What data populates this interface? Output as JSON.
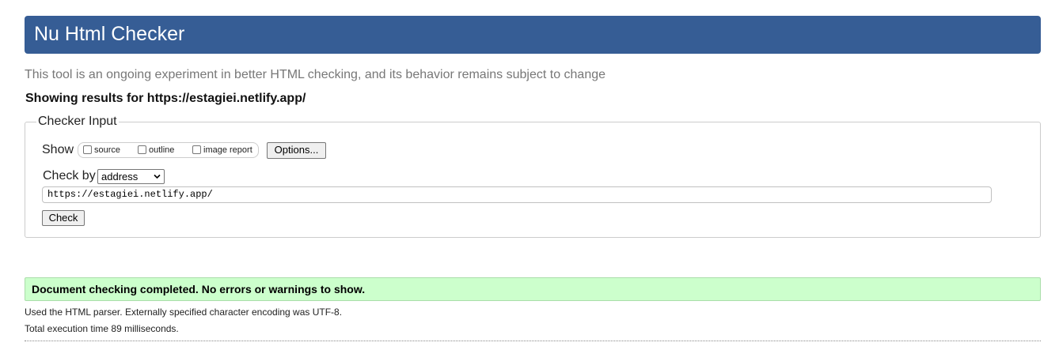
{
  "header": {
    "title": "Nu Html Checker",
    "bg_color": "#365d95"
  },
  "tagline": "This tool is an ongoing experiment in better HTML checking, and its behavior remains subject to change",
  "results_for": "Showing results for https://estagiei.netlify.app/",
  "checker_input": {
    "legend": "Checker Input",
    "show_label": "Show",
    "show_options": [
      {
        "label": "source",
        "checked": false
      },
      {
        "label": "outline",
        "checked": false
      },
      {
        "label": "image report",
        "checked": false
      }
    ],
    "options_button": "Options...",
    "check_by_label": "Check by",
    "check_by_selected": "address",
    "url_value": "https://estagiei.netlify.app/",
    "check_button": "Check"
  },
  "result": {
    "message": "Document checking completed. No errors or warnings to show.",
    "bg_color": "#ccffcc",
    "details": [
      "Used the HTML parser. Externally specified character encoding was UTF-8.",
      "Total execution time 89 milliseconds."
    ]
  }
}
